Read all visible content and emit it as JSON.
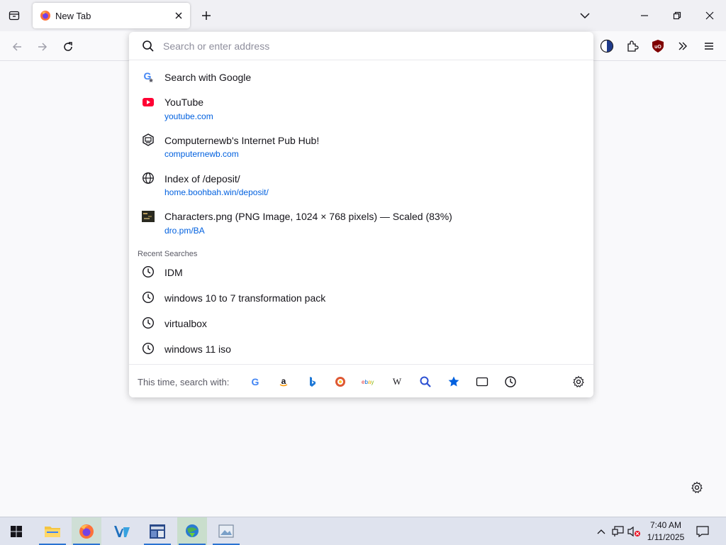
{
  "tabs": [
    {
      "title": "New Tab"
    }
  ],
  "urlbar": {
    "placeholder": "Search or enter address"
  },
  "results": [
    {
      "title": "Search with Google",
      "url": "",
      "icon": "google-icon"
    },
    {
      "title": "YouTube",
      "url": "youtube.com",
      "icon": "youtube-icon"
    },
    {
      "title": "Computernewb's Internet Pub Hub!",
      "url": "computernewb.com",
      "icon": "computernewb-icon"
    },
    {
      "title": "Index of /deposit/",
      "url": "home.boohbah.win/deposit/",
      "icon": "globe-icon"
    },
    {
      "title": "Characters.png (PNG Image, 1024 × 768 pixels) — Scaled (83%)",
      "url": "dro.pm/BA",
      "icon": "image-thumbnail-icon"
    }
  ],
  "recent_searches": {
    "heading": "Recent Searches",
    "items": [
      "IDM",
      "windows 10 to 7 transformation pack",
      "virtualbox",
      "windows 11 iso"
    ]
  },
  "oneoff": {
    "label": "This time, search with:",
    "engines": [
      "google",
      "amazon",
      "bing",
      "duckduckgo",
      "ebay",
      "wikipedia",
      "search",
      "bookmarks",
      "tabs",
      "history"
    ]
  },
  "clock": {
    "time": "7:40 AM",
    "date": "1/11/2025"
  },
  "colors": {
    "accent": "#0060df",
    "youtube": "#ff0033",
    "ublock": "#800000",
    "taskbar": "#dfe3ee"
  }
}
